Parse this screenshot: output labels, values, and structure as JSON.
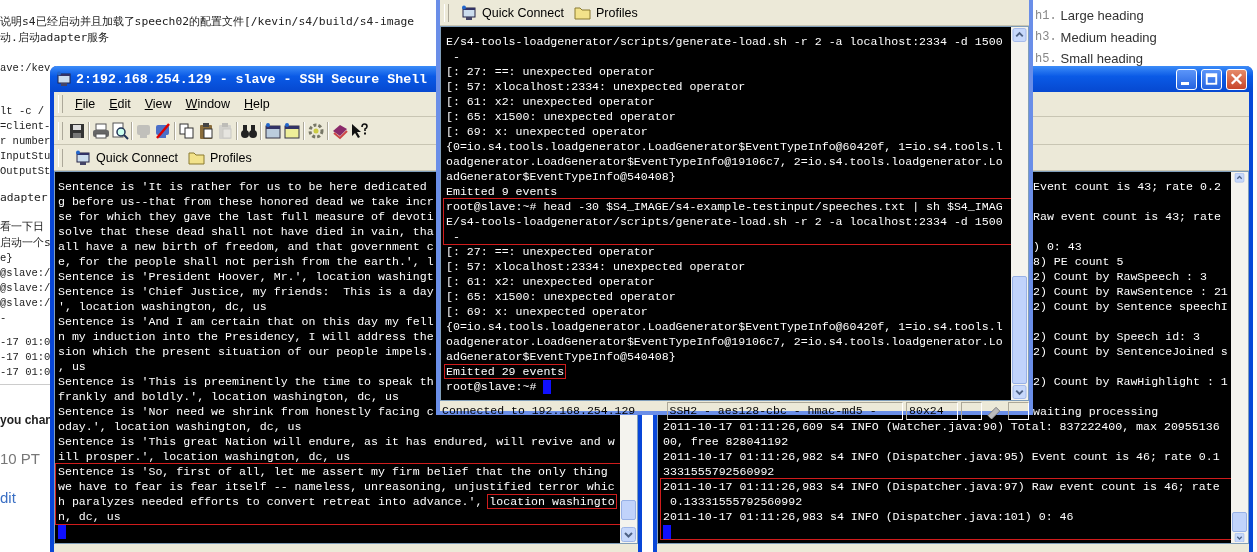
{
  "page": {
    "blocks": [
      {
        "kind": "para",
        "lines": [
          "说明s4已经启动并且加载了speech02的配置文件[/kevin/s4/build/s4-image",
          "动.启动adapter服务"
        ]
      },
      {
        "kind": "code",
        "lines": [
          "ave:/kev"
        ]
      },
      {
        "kind": "code",
        "lines": [
          "lt -c /",
          "=client-",
          "r number",
          "InputStu",
          "OutputSt"
        ]
      },
      {
        "kind": "para",
        "lines": [
          "adapter"
        ]
      },
      {
        "kind": "para",
        "lines": [
          "看一下日",
          "启动一个s"
        ]
      },
      {
        "kind": "code",
        "lines": [
          "e}",
          "@slave:/",
          "@slave:/",
          "@slave:/",
          "-"
        ]
      },
      {
        "kind": "code",
        "lines": [
          "-17 01:0",
          "-17 01:0",
          "-17 01:0"
        ]
      },
      {
        "kind": "strong",
        "lines": [
          "you chan"
        ]
      },
      {
        "kind": "large",
        "lines": [
          "10 PT"
        ]
      },
      {
        "kind": "link",
        "lines": [
          "dit"
        ]
      }
    ],
    "headings": [
      {
        "tag": "h1.",
        "text": "Large heading"
      },
      {
        "tag": "h3.",
        "text": "Medium heading"
      },
      {
        "tag": "h5.",
        "text": "Small heading"
      }
    ]
  },
  "left_window": {
    "title": "2:192.168.254.129 - slave - SSH Secure Shell",
    "menu": [
      "File",
      "Edit",
      "View",
      "Window",
      "Help"
    ],
    "toolbar_groups": [
      {
        "buttons": [
          {
            "kind": "save",
            "disabled": false
          }
        ]
      },
      {
        "buttons": [
          {
            "kind": "print",
            "disabled": false
          },
          {
            "kind": "preview",
            "disabled": false
          }
        ]
      },
      {
        "buttons": [
          {
            "kind": "connect",
            "disabled": true
          },
          {
            "kind": "disconnect",
            "disabled": false
          }
        ]
      },
      {
        "buttons": [
          {
            "kind": "copy",
            "disabled": false
          },
          {
            "kind": "paste",
            "disabled": false
          },
          {
            "kind": "paste",
            "disabled": true
          }
        ]
      },
      {
        "buttons": [
          {
            "kind": "find",
            "disabled": false
          }
        ]
      },
      {
        "buttons": [
          {
            "kind": "new-terminal",
            "disabled": false
          },
          {
            "kind": "new-transfer",
            "disabled": false
          }
        ]
      },
      {
        "buttons": [
          {
            "kind": "settings",
            "disabled": false
          }
        ]
      },
      {
        "buttons": [
          {
            "kind": "help",
            "disabled": false
          },
          {
            "kind": "context-help",
            "disabled": false
          }
        ]
      }
    ],
    "quick_connect": "Quick Connect",
    "profiles": "Profiles",
    "terminal": [
      {
        "kind": "line",
        "text": "Sentence is 'It is rather for us to be here dedicated"
      },
      {
        "kind": "line",
        "text": "g before us--that from these honored dead we take incr"
      },
      {
        "kind": "line",
        "text": "se for which they gave the last full measure of devoti"
      },
      {
        "kind": "line",
        "text": "solve that these dead shall not have died in vain, tha"
      },
      {
        "kind": "line",
        "text": "all have a new birth of freedom, and that government c"
      },
      {
        "kind": "line",
        "text": "e, for the people shall not perish from the earth.', l"
      },
      {
        "kind": "line",
        "text": "Sentence is 'President Hoover, Mr.', location washingt"
      },
      {
        "kind": "line",
        "text": "Sentence is 'Chief Justice, my friends:  This is a day"
      },
      {
        "kind": "line",
        "text": "', location washington, dc, us"
      },
      {
        "kind": "line",
        "text": "Sentence is 'And I am certain that on this day my fell"
      },
      {
        "kind": "line",
        "text": "n my induction into the Presidency, I will address the"
      },
      {
        "kind": "line",
        "text": "sion which the present situation of our people impels."
      },
      {
        "kind": "line",
        "text": ", us"
      },
      {
        "kind": "line",
        "text": "Sentence is 'This is preeminently the time to speak th"
      },
      {
        "kind": "line",
        "text": "frankly and boldly.', location washington, dc, us"
      },
      {
        "kind": "line",
        "text": "Sentence is 'Nor need we shrink from honestly facing c"
      },
      {
        "kind": "line",
        "text": "oday.', location washington, dc, us"
      },
      {
        "kind": "line",
        "text": "Sentence is 'This great Nation will endure, as it has endured, will revive and w"
      },
      {
        "kind": "line",
        "text": "ill prosper.', location washington, dc, us"
      },
      {
        "kind": "box",
        "entries": [
          {
            "kind": "line",
            "text": "Sentence is 'So, first of all, let me assert my firm belief that the only thing"
          },
          {
            "kind": "line",
            "text": "we have to fear is fear itself -- nameless, unreasoning, unjustified terror whic"
          },
          {
            "kind": "line",
            "text": "h paralyzes needed efforts to convert retreat into advance.', ",
            "tail": "location washingto"
          },
          {
            "kind": "line",
            "text": "n, dc, us"
          }
        ]
      },
      {
        "kind": "cursor"
      }
    ]
  },
  "center_window": {
    "quick_connect": "Quick Connect",
    "profiles": "Profiles",
    "terminal": [
      {
        "kind": "line",
        "text": "E/s4-tools-loadgenerator/scripts/generate-load.sh -r 2 -a localhost:2334 -d 1500"
      },
      {
        "kind": "line",
        "text": " -"
      },
      {
        "kind": "line",
        "text": "[: 27: ==: unexpected operator"
      },
      {
        "kind": "line",
        "text": "[: 57: xlocalhost:2334: unexpected operator"
      },
      {
        "kind": "line",
        "text": "[: 61: x2: unexpected operator"
      },
      {
        "kind": "line",
        "text": "[: 65: x1500: unexpected operator"
      },
      {
        "kind": "line",
        "text": "[: 69: x: unexpected operator"
      },
      {
        "kind": "line",
        "text": "{0=io.s4.tools.loadgenerator.LoadGenerator$EventTypeInfo@60420f, 1=io.s4.tools.l"
      },
      {
        "kind": "line",
        "text": "oadgenerator.LoadGenerator$EventTypeInfo@19106c7, 2=io.s4.tools.loadgenerator.Lo"
      },
      {
        "kind": "line",
        "text": "adGenerator$EventTypeInfo@540408}"
      },
      {
        "kind": "line",
        "text": "Emitted 9 events"
      },
      {
        "kind": "box",
        "entries": [
          {
            "kind": "line",
            "text": "root@slave:~# head -30 $S4_IMAGE/s4-example-testinput/speeches.txt | sh $S4_IMAG"
          },
          {
            "kind": "line",
            "text": "E/s4-tools-loadgenerator/scripts/generate-load.sh -r 2 -a localhost:2334 -d 1500"
          },
          {
            "kind": "line",
            "text": " -"
          }
        ]
      },
      {
        "kind": "line",
        "text": "[: 27: ==: unexpected operator"
      },
      {
        "kind": "line",
        "text": "[: 57: xlocalhost:2334: unexpected operator"
      },
      {
        "kind": "line",
        "text": "[: 61: x2: unexpected operator"
      },
      {
        "kind": "line",
        "text": "[: 65: x1500: unexpected operator"
      },
      {
        "kind": "line",
        "text": "[: 69: x: unexpected operator"
      },
      {
        "kind": "line",
        "text": "{0=io.s4.tools.loadgenerator.LoadGenerator$EventTypeInfo@60420f, 1=io.s4.tools.l"
      },
      {
        "kind": "line",
        "text": "oadgenerator.LoadGenerator$EventTypeInfo@19106c7, 2=io.s4.tools.loadgenerator.Lo"
      },
      {
        "kind": "line",
        "text": "adGenerator$EventTypeInfo@540408}"
      },
      {
        "kind": "fit-box",
        "text": "Emitted 29 events"
      },
      {
        "kind": "cursor",
        "text": "root@slave:~# "
      }
    ],
    "status_bar": {
      "connection": "Connected to 192.168.254.129",
      "cipher": "SSH2 - aes128-cbc - hmac-md5 -",
      "size": "80x24"
    }
  },
  "right_window": {
    "terminal_beside": [
      {
        "kind": "line",
        "text": "Event count is 43; rate 0.2"
      },
      {
        "kind": "blank"
      },
      {
        "kind": "line",
        "text": "Raw event count is 43; rate"
      },
      {
        "kind": "blank"
      },
      {
        "kind": "line",
        "text": ") 0: 43"
      },
      {
        "kind": "line",
        "text": "8) PE count 5"
      },
      {
        "kind": "line",
        "text": "2) Count by RawSpeech : 3"
      },
      {
        "kind": "line",
        "text": "2) Count by RawSentence : 21"
      },
      {
        "kind": "line",
        "text": "2) Count by Sentence speechI"
      },
      {
        "kind": "blank"
      },
      {
        "kind": "line",
        "text": "2) Count by Speech id: 3"
      },
      {
        "kind": "line",
        "text": "2) Count by SentenceJoined s"
      },
      {
        "kind": "blank"
      },
      {
        "kind": "line",
        "text": "2) Count by RawHighlight : 1"
      },
      {
        "kind": "blank"
      },
      {
        "kind": "line",
        "text": "waiting processing"
      }
    ],
    "terminal": [
      {
        "kind": "line",
        "text": "2011-10-17 01:11:26,609 s4 INFO (Watcher.java:90) Total: 837222400, max 20955136"
      },
      {
        "kind": "line",
        "text": "00, free 828041192"
      },
      {
        "kind": "line",
        "text": "2011-10-17 01:11:26,982 s4 INFO (Dispatcher.java:95) Event count is 46; rate 0.1"
      },
      {
        "kind": "line",
        "text": "3331555792560992"
      },
      {
        "kind": "box",
        "entries": [
          {
            "kind": "line",
            "text": "2011-10-17 01:11:26,983 s4 INFO (Dispatcher.java:97) Raw event count is 46; rate"
          },
          {
            "kind": "line",
            "text": " 0.13331555792560992"
          },
          {
            "kind": "line",
            "text": "2011-10-17 01:11:26,983 s4 INFO (Dispatcher.java:101) 0: 46"
          },
          {
            "kind": "cursor"
          }
        ]
      }
    ]
  }
}
